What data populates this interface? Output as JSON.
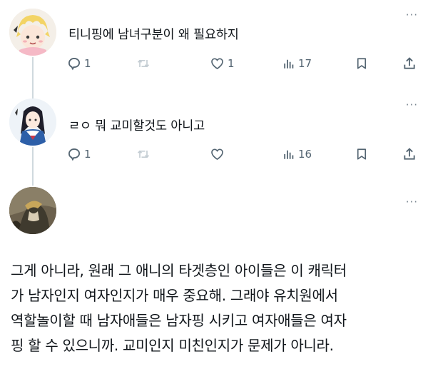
{
  "tweets": [
    {
      "text": "티니핑에 남녀구분이 왜 필요하지",
      "more": "···",
      "stats": {
        "replies": "1",
        "retweets": "",
        "likes": "1",
        "views": "17"
      }
    },
    {
      "text": "ㄹㅇ 뭐 교미할것도 아니고",
      "more": "···",
      "stats": {
        "replies": "1",
        "retweets": "",
        "likes": "",
        "views": "16"
      }
    }
  ],
  "reply": {
    "more": "···",
    "lines": [
      "그게 아니라, 원래 그 애니의 타겟층인 아이들은 이 캐릭터",
      "가 남자인지 여자인지가 매우 중요해. 그래야 유치원에서",
      "역할놀이할 때 남자애들은 남자핑 시키고 여자애들은 여자",
      "핑 할 수 있으니까. 교미인지 미친인지가 문제가 아니라."
    ]
  },
  "colors": {
    "text": "#0f1419",
    "icon": "#536471",
    "thread_line": "#cfd9de"
  }
}
